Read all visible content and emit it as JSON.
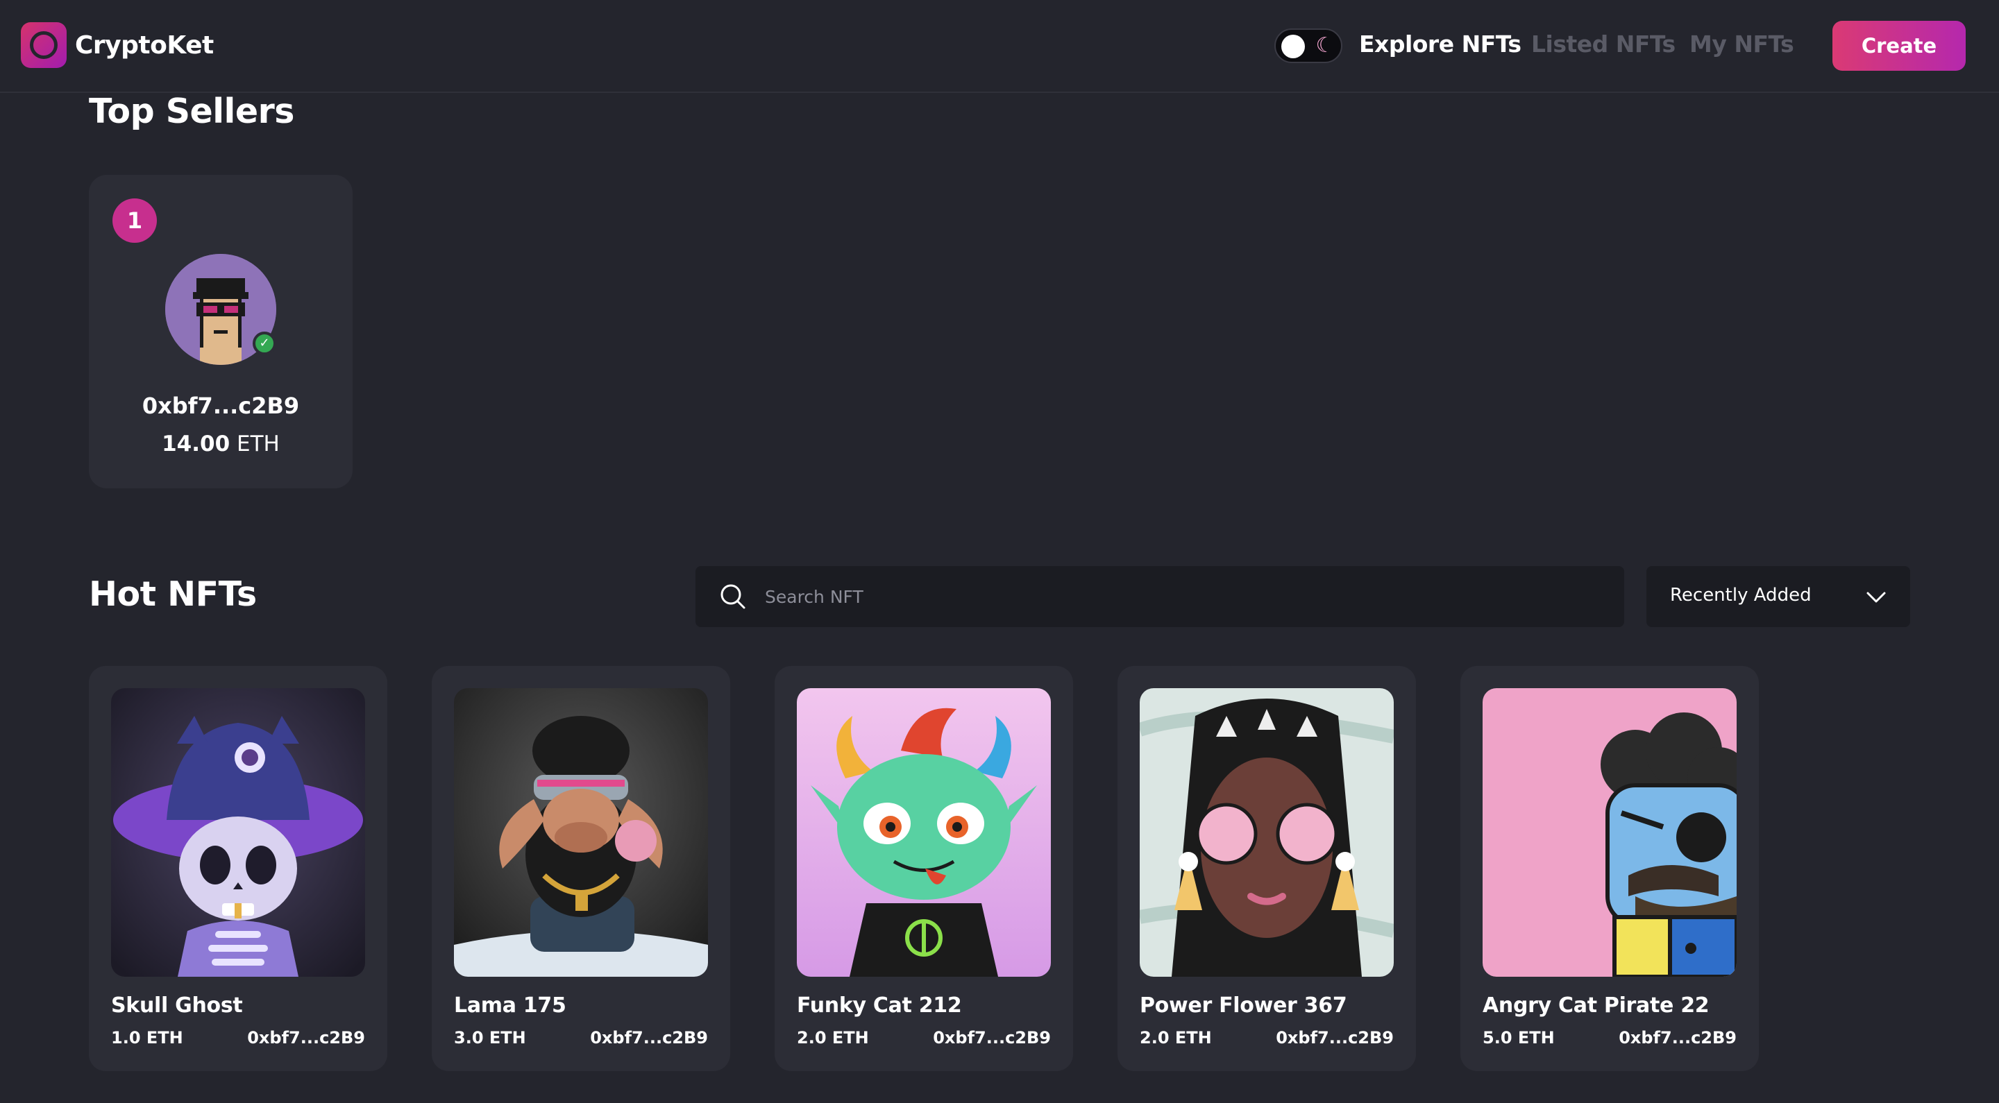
{
  "app": {
    "name": "CryptoKet"
  },
  "nav": {
    "links": [
      "Explore NFTs",
      "Listed NFTs",
      "My NFTs"
    ],
    "create_label": "Create",
    "theme_icon": "moon-icon"
  },
  "top_sellers": {
    "title": "Top Sellers",
    "sellers": [
      {
        "rank": "1",
        "address": "0xbf7...c2B9",
        "amount": "14.00",
        "currency": "ETH"
      }
    ]
  },
  "hot_nfts": {
    "title": "Hot NFTs",
    "search_placeholder": "Search NFT",
    "sort_label": "Recently Added",
    "items": [
      {
        "name": "Skull Ghost",
        "price": "1.0 ETH",
        "owner": "0xbf7...c2B9"
      },
      {
        "name": "Lama 175",
        "price": "3.0 ETH",
        "owner": "0xbf7...c2B9"
      },
      {
        "name": "Funky Cat 212",
        "price": "2.0 ETH",
        "owner": "0xbf7...c2B9"
      },
      {
        "name": "Power Flower 367",
        "price": "2.0 ETH",
        "owner": "0xbf7...c2B9"
      },
      {
        "name": "Angry Cat Pirate 22",
        "price": "5.0 ETH",
        "owner": "0xbf7...c2B9"
      }
    ]
  },
  "colors": {
    "background": "#24252d",
    "card": "#2c2d36",
    "accent": "#da3a74",
    "muted_link": "#5a5b66"
  }
}
